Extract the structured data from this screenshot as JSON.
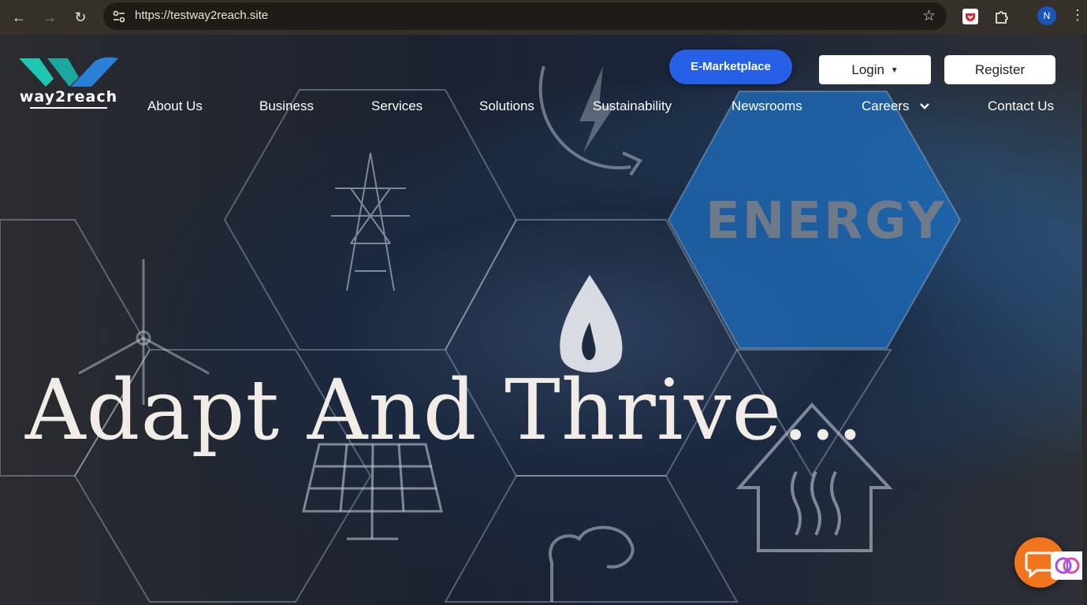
{
  "browser": {
    "url": "https://testway2reach.site",
    "profile_initial": "N",
    "icons": [
      "back-icon",
      "forward-icon",
      "reload-icon",
      "site-settings-icon",
      "star-icon",
      "pocket-extension-icon",
      "extensions-icon",
      "kebab-menu-icon"
    ]
  },
  "header": {
    "logo_text": "way2reach",
    "emarketplace_label": "E-Marketplace",
    "login_label": "Login",
    "register_label": "Register"
  },
  "nav": {
    "items": [
      "About Us",
      "Business",
      "Services",
      "Solutions",
      "Sustainability",
      "Newsrooms",
      "Careers",
      "Contact Us"
    ]
  },
  "hero": {
    "headline": "Adapt And Thrive...",
    "energy_text": "ENERGY"
  },
  "colors": {
    "accent_blue": "#2560e6",
    "chat_orange": "#f0751c",
    "logo_teal": "#1fc7b0",
    "logo_blue": "#2c7fd6"
  }
}
